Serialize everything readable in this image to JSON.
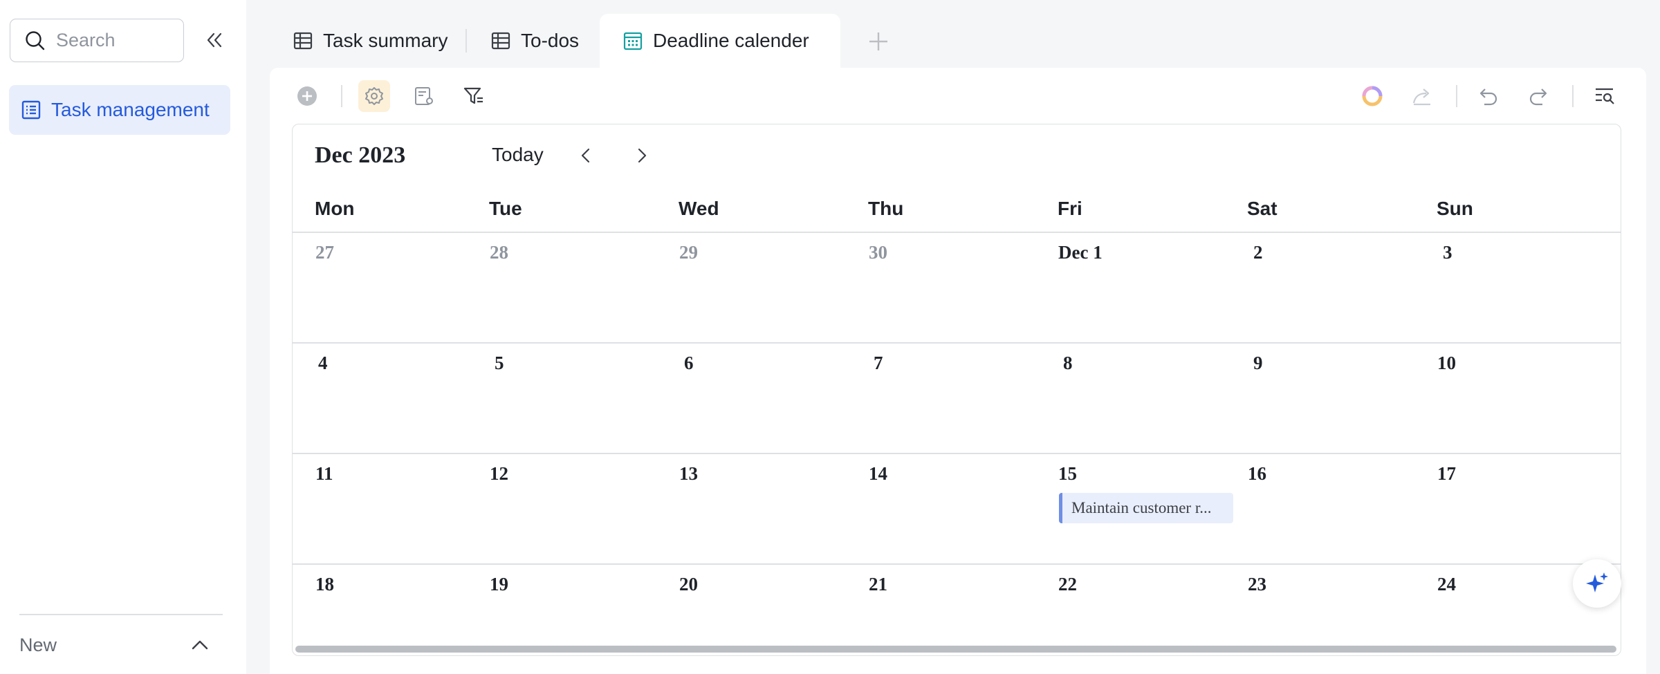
{
  "sidebar": {
    "search": {
      "placeholder": "Search",
      "value": ""
    },
    "items": [
      {
        "label": "Task management",
        "icon": "table-icon",
        "active": true
      }
    ],
    "footer": {
      "label": "New"
    }
  },
  "tabs": [
    {
      "label": "Task summary",
      "icon": "grid-table-icon"
    },
    {
      "label": "To-dos",
      "icon": "grid-table-icon"
    },
    {
      "label": "Deadline calender",
      "icon": "calendar-icon",
      "active": true
    }
  ],
  "toolbar": {
    "left": [
      "add-record-icon",
      "settings-icon",
      "form-settings-icon",
      "filter-icon"
    ],
    "right": [
      "ai-assistant-icon",
      "share-icon",
      "undo-icon",
      "redo-icon",
      "search-records-icon"
    ]
  },
  "calendar": {
    "month_title": "Dec 2023",
    "today_label": "Today",
    "weekdays": [
      "Mon",
      "Tue",
      "Wed",
      "Thu",
      "Fri",
      "Sat",
      "Sun"
    ],
    "weeks": [
      [
        "27",
        "28",
        "29",
        "30",
        "Dec 1",
        "2",
        "3"
      ],
      [
        "4",
        "5",
        "6",
        "7",
        "8",
        "9",
        "10"
      ],
      [
        "11",
        "12",
        "13",
        "14",
        "15",
        "16",
        "17"
      ],
      [
        "18",
        "19",
        "20",
        "21",
        "22",
        "23",
        "24"
      ]
    ],
    "muted_days_first_week": 4,
    "events": [
      {
        "title": "Maintain customer r...",
        "week": 2,
        "day": 4
      }
    ]
  },
  "colors": {
    "accent": "#245bdb",
    "nav_active_bg": "#e9eefc",
    "calendar_tab_icon": "#14a0a0",
    "event_bar": "#6f8fe4",
    "settings_active_bg": "#fdf0d8"
  }
}
